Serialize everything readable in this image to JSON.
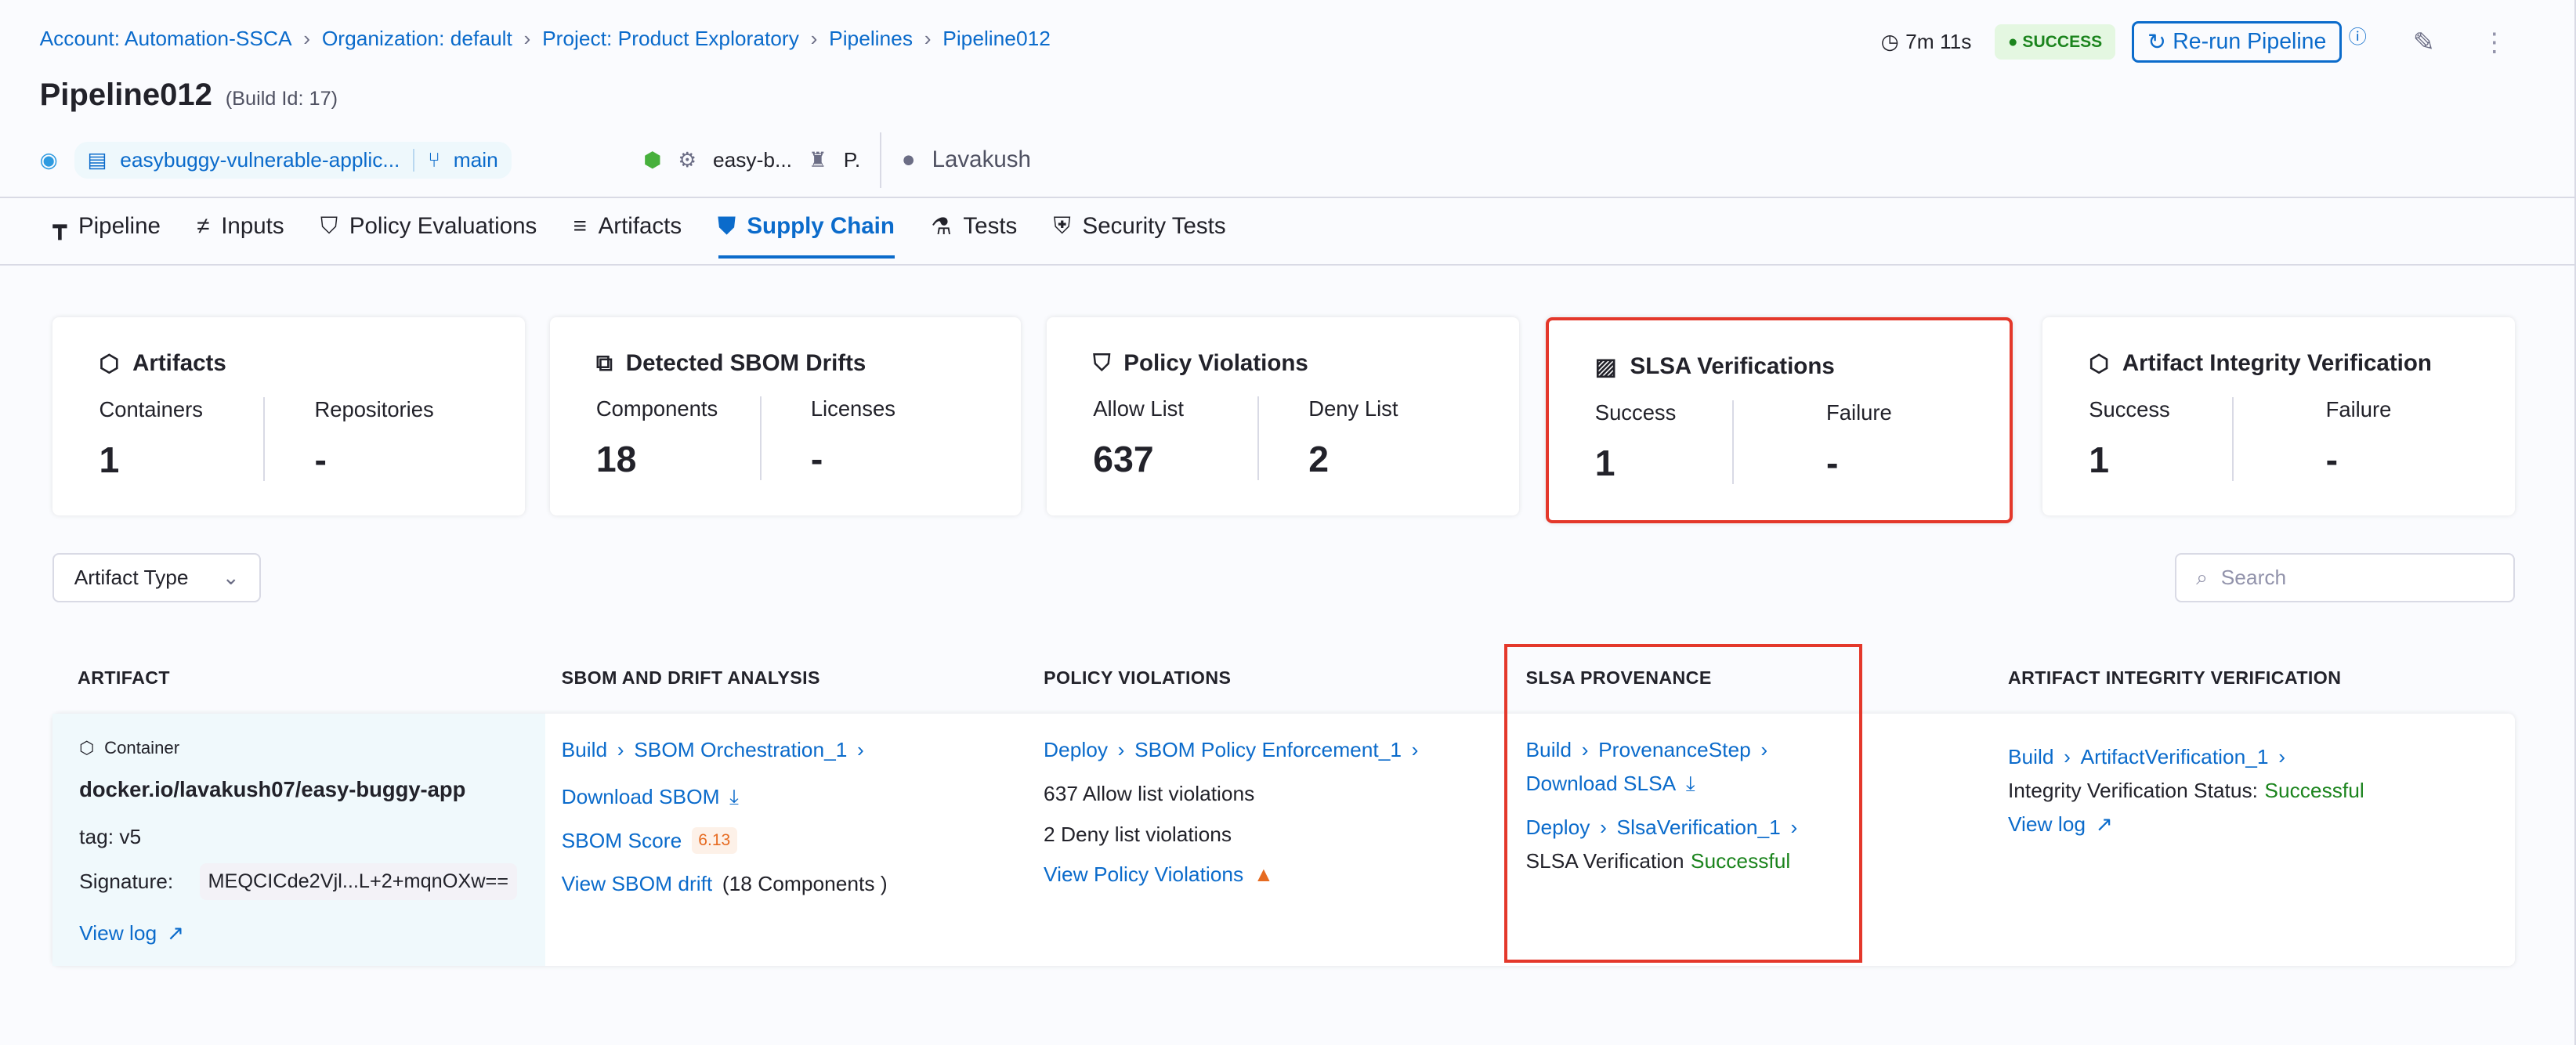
{
  "breadcrumb": [
    "Account: Automation-SSCA",
    "Organization: default",
    "Project: Product Exploratory",
    "Pipelines",
    "Pipeline012"
  ],
  "header": {
    "title": "Pipeline012",
    "build_id": "(Build Id: 17)",
    "duration": "7m 11s",
    "status": "SUCCESS",
    "rerun": "Re-run Pipeline"
  },
  "meta": {
    "repo": "easybuggy-vulnerable-applic...",
    "branch": "main",
    "service": "easy-b...",
    "infra": "P.",
    "user": "Lavakush"
  },
  "tabs": [
    "Pipeline",
    "Inputs",
    "Policy Evaluations",
    "Artifacts",
    "Supply Chain",
    "Tests",
    "Security Tests"
  ],
  "active_tab": "Supply Chain",
  "cards": [
    {
      "title": "Artifacts",
      "a_label": "Containers",
      "a_value": "1",
      "b_label": "Repositories",
      "b_value": "-"
    },
    {
      "title": "Detected SBOM Drifts",
      "a_label": "Components",
      "a_value": "18",
      "b_label": "Licenses",
      "b_value": "-"
    },
    {
      "title": "Policy Violations",
      "a_label": "Allow List",
      "a_value": "637",
      "b_label": "Deny List",
      "b_value": "2"
    },
    {
      "title": "SLSA Verifications",
      "a_label": "Success",
      "a_value": "1",
      "b_label": "Failure",
      "b_value": "-"
    },
    {
      "title": "Artifact Integrity Verification",
      "a_label": "Success",
      "a_value": "1",
      "b_label": "Failure",
      "b_value": "-"
    }
  ],
  "filter": {
    "artifact_type": "Artifact Type",
    "search_placeholder": "Search"
  },
  "table": {
    "headers": [
      "ARTIFACT",
      "SBOM AND DRIFT ANALYSIS",
      "POLICY VIOLATIONS",
      "SLSA PROVENANCE",
      "ARTIFACT INTEGRITY VERIFICATION"
    ],
    "artifact": {
      "type": "Container",
      "name": "docker.io/lavakush07/easy-buggy-app",
      "tag": "tag: v5",
      "signature_label": "Signature:",
      "signature": "MEQCICde2Vjl...L+2+mqnOXw==",
      "view_log": "View log"
    },
    "sbom": {
      "stage": "Build",
      "step": "SBOM Orchestration_1",
      "download": "Download SBOM",
      "score_label": "SBOM Score",
      "score": "6.13",
      "drift": "View SBOM drift",
      "drift_count": "(18 Components )"
    },
    "policy": {
      "stage": "Deploy",
      "step": "SBOM Policy Enforcement_1",
      "allow": "637 Allow list violations",
      "deny": "2 Deny list violations",
      "view": "View Policy Violations"
    },
    "slsa": {
      "stage": "Build",
      "step": "ProvenanceStep",
      "download": "Download SLSA",
      "stage2": "Deploy",
      "step2": "SlsaVerification_1",
      "verif_label": "SLSA Verification",
      "verif_status": "Successful"
    },
    "integrity": {
      "stage": "Build",
      "step": "ArtifactVerification_1",
      "status_label": "Integrity Verification Status:",
      "status": "Successful",
      "view_log": "View log"
    }
  }
}
